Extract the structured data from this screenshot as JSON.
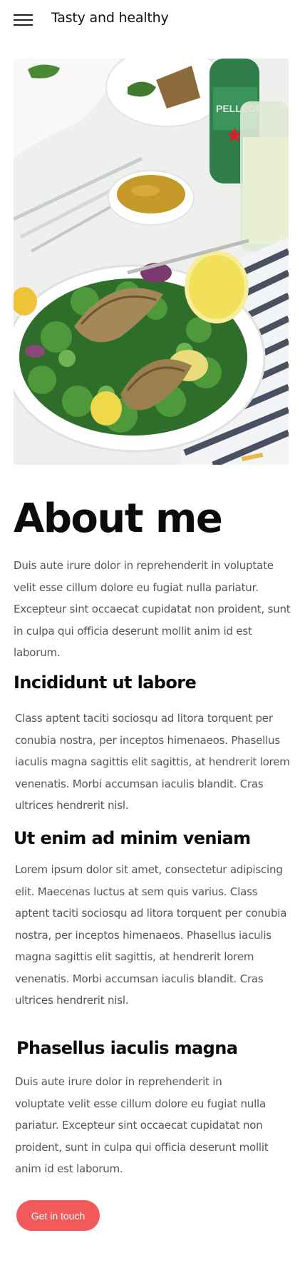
{
  "header": {
    "menu_icon": "hamburger-menu-icon",
    "title": "Tasty and healthy"
  },
  "hero": {
    "image": "salad-plate-photo"
  },
  "about": {
    "heading": "About me",
    "text": "Duis aute irure dolor in reprehenderit in voluptate velit esse cillum dolore eu fugiat nulla pariatur. Excepteur sint occaecat cupidatat non proident, sunt in culpa qui officia deserunt mollit anim id est laborum."
  },
  "sections": [
    {
      "heading": "Incididunt ut labore",
      "text": "Class aptent taciti sociosqu ad litora torquent per conubia nostra, per inceptos himenaeos. Phasellus iaculis magna sagittis elit sagittis, at hendrerit lorem venenatis. Morbi accumsan iaculis blandit. Cras ultrices hendrerit nisl."
    },
    {
      "heading": "Ut enim ad minim veniam",
      "text": "Lorem ipsum dolor sit amet, consectetur adipiscing elit. Maecenas luctus at sem quis varius. Class aptent taciti sociosqu ad litora torquent per conubia nostra, per inceptos himenaeos. Phasellus iaculis magna sagittis elit sagittis, at hendrerit lorem venenatis. Morbi accumsan iaculis blandit. Cras ultrices hendrerit nisl."
    },
    {
      "heading": "Phasellus iaculis magna",
      "text": "Duis aute irure dolor in reprehenderit in voluptate velit esse cillum dolore eu fugiat nulla pariatur. Excepteur sint occaecat cupidatat non proident, sunt in culpa qui officia deserunt mollit anim id est laborum."
    }
  ],
  "cta": {
    "label": "Get in touch"
  },
  "colors": {
    "accent": "#f2595a",
    "text": "#111111",
    "body_text": "#555555"
  }
}
